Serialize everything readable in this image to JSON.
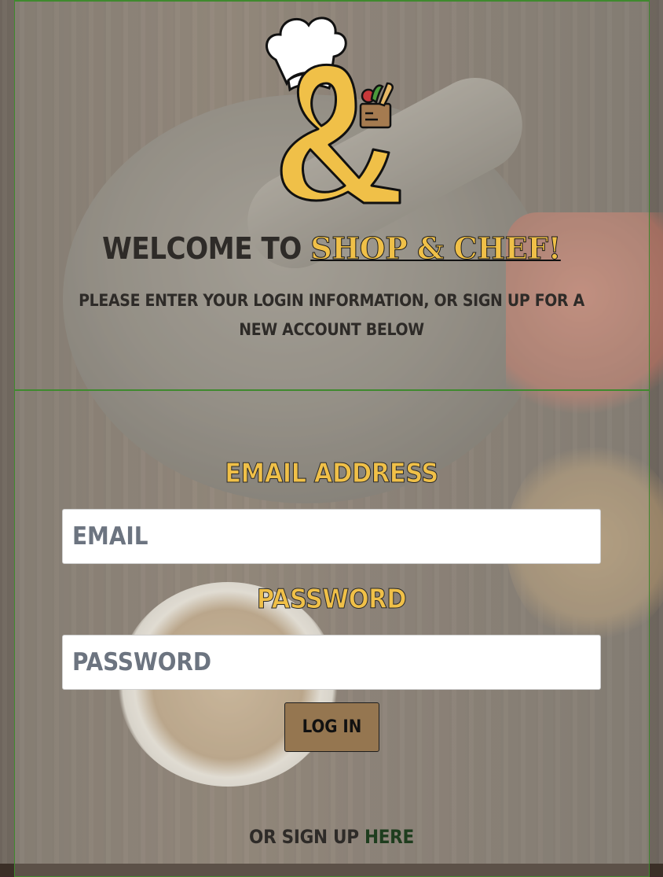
{
  "header": {
    "welcome_prefix": "Welcome to ",
    "brand_name": "Shop & Chef!",
    "subtitle": "Please enter your login information, or sign up for a new account below"
  },
  "form": {
    "email_label": "Email Address",
    "email_placeholder": "Email",
    "password_label": "Password",
    "password_placeholder": "Password",
    "login_button": "Log In"
  },
  "footer": {
    "signup_prefix": "or sign up ",
    "signup_link": "here"
  },
  "colors": {
    "accent": "#f0c048",
    "button": "#957650",
    "border_green": "#3f8a2e"
  },
  "icons": {
    "logo": "ampersand-chef-hat-grocery-bag-logo"
  }
}
